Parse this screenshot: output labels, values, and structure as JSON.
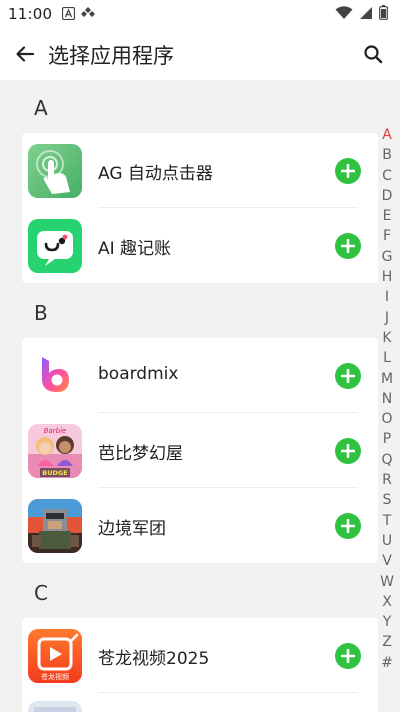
{
  "status_bar": {
    "time": "11:00",
    "left_icons": [
      "font-a-icon",
      "diamond-app-icon"
    ],
    "right_icons": [
      "wifi-icon",
      "cell-signal-icon",
      "battery-icon"
    ]
  },
  "app_bar": {
    "title": "选择应用程序",
    "back_icon": "arrow-left-icon",
    "search_icon": "search-icon"
  },
  "colors": {
    "add_green": "#2fc23e",
    "index_active": "#e0393e",
    "background": "#f2f2f2"
  },
  "sections": [
    {
      "letter": "A",
      "apps": [
        {
          "name": "AG 自动点击器",
          "icon": "ag-auto-clicker-icon"
        },
        {
          "name": "AI 趣记账",
          "icon": "ai-bookkeeping-icon"
        }
      ]
    },
    {
      "letter": "B",
      "apps": [
        {
          "name": "boardmix",
          "icon": "boardmix-icon"
        },
        {
          "name": "芭比梦幻屋",
          "icon": "barbie-dreamhouse-icon"
        },
        {
          "name": "边境军团",
          "icon": "border-legion-icon"
        }
      ]
    },
    {
      "letter": "C",
      "apps": [
        {
          "name": "苍龙视频2025",
          "icon": "canglong-video-icon"
        }
      ]
    }
  ],
  "icon_texts": {
    "budge": "BUDGE",
    "barbie": "Barbie",
    "canglong": "苍龙视频"
  },
  "index_letters": [
    "A",
    "B",
    "C",
    "D",
    "E",
    "F",
    "G",
    "H",
    "I",
    "J",
    "K",
    "L",
    "M",
    "N",
    "O",
    "P",
    "Q",
    "R",
    "S",
    "T",
    "U",
    "V",
    "W",
    "X",
    "Y",
    "Z",
    "#"
  ],
  "index_active": "A"
}
